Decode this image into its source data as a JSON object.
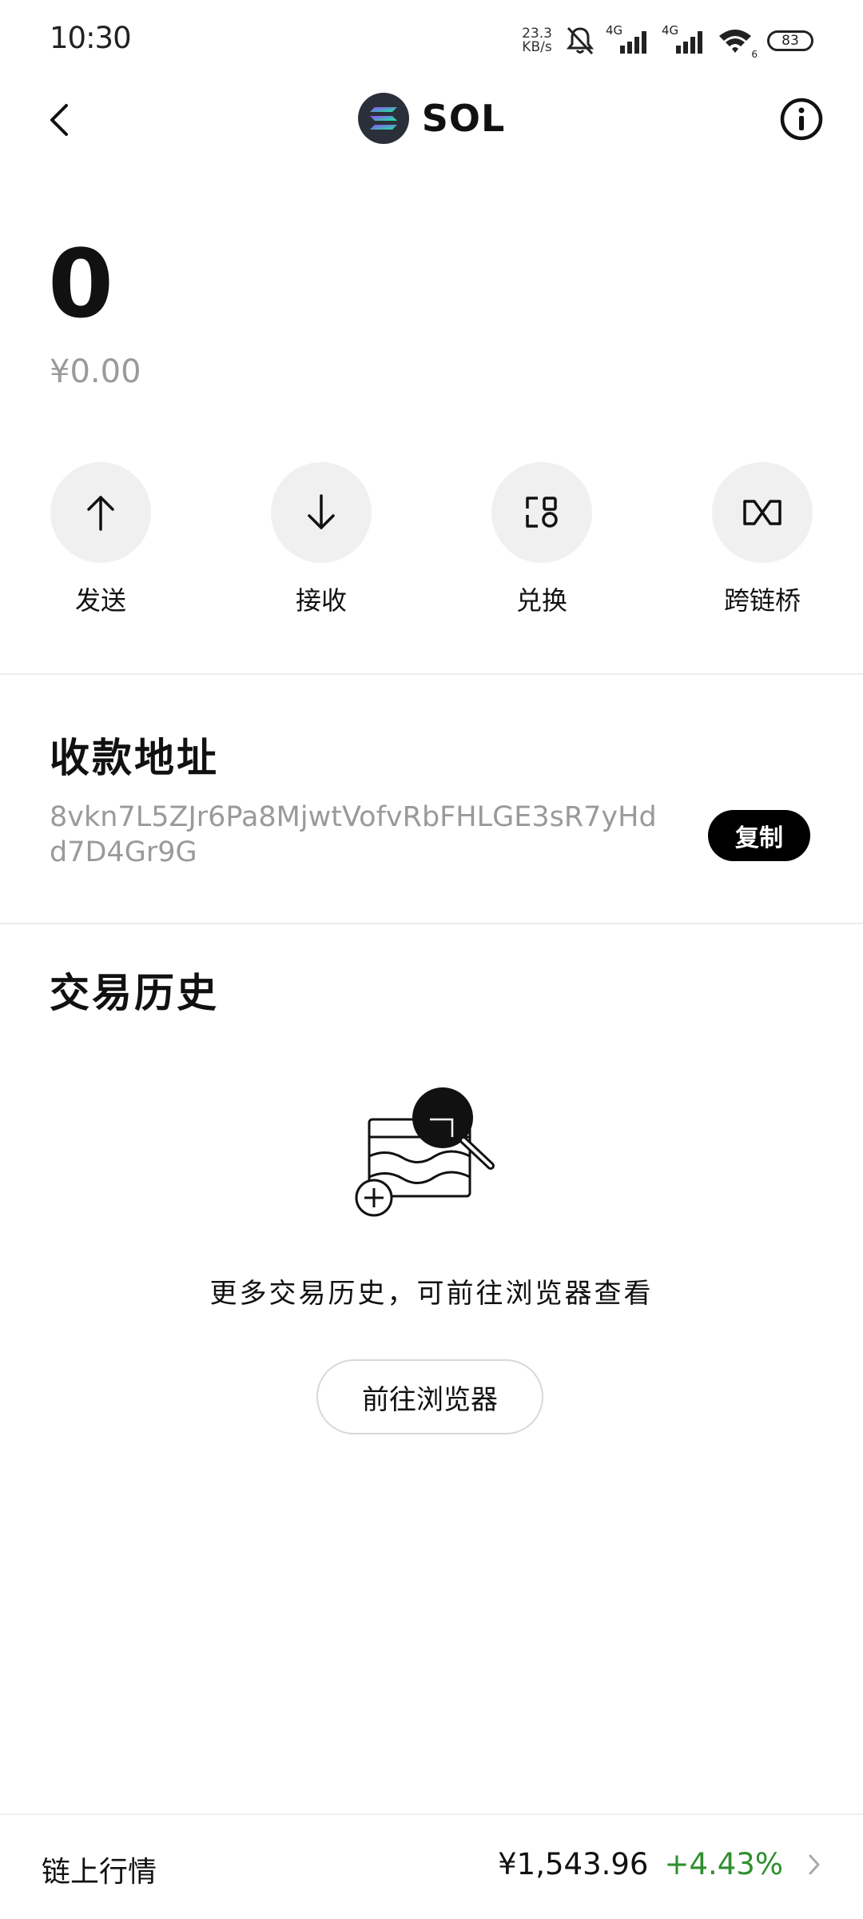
{
  "status_bar": {
    "time": "10:30",
    "net_speed_value": "23.3",
    "net_speed_unit": "KB/s",
    "signal_1_label": "4G",
    "signal_2_label": "4G",
    "wifi_badge": "6",
    "battery": "83"
  },
  "header": {
    "title": "SOL"
  },
  "balance": {
    "amount": "0",
    "fiat": "¥0.00"
  },
  "actions": [
    {
      "label": "发送",
      "icon": "arrow-up-icon"
    },
    {
      "label": "接收",
      "icon": "arrow-down-icon"
    },
    {
      "label": "兑换",
      "icon": "swap-icon"
    },
    {
      "label": "跨链桥",
      "icon": "bridge-icon"
    }
  ],
  "address_section": {
    "title": "收款地址",
    "address": "8vkn7L5ZJr6Pa8MjwtVofvRbFHLGE3sR7yHdd7D4Gr9G",
    "copy_label": "复制"
  },
  "history_section": {
    "title": "交易历史",
    "empty_text": "更多交易历史，可前往浏览器查看",
    "browser_button": "前往浏览器"
  },
  "market_bar": {
    "label": "链上行情",
    "price": "¥1,543.96",
    "change": "+4.43%"
  },
  "colors": {
    "positive": "#2f8f2f",
    "muted_text": "#9a9a9a",
    "action_bg": "#f0f0f0"
  }
}
